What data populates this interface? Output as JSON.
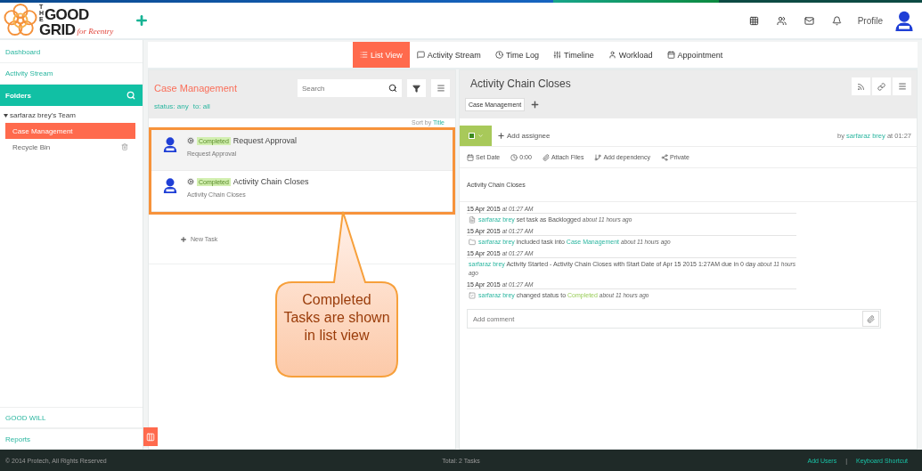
{
  "logo": {
    "small": "THE",
    "line1": "GOOD",
    "line2": "GRID",
    "tagline": "for Reentry"
  },
  "header": {
    "profile": "Profile"
  },
  "sidebar": {
    "top_items": [
      "Dashboard",
      "Activity Stream"
    ],
    "folders_label": "Folders",
    "team": "sarfaraz brey's Team",
    "folders": [
      {
        "label": "Case Management",
        "selected": true
      },
      {
        "label": "Recycle Bin",
        "selected": false
      }
    ],
    "bottom_items": [
      "GOOD WILL",
      "Reports"
    ]
  },
  "tabs": [
    {
      "label": "List View",
      "selected": true
    },
    {
      "label": "Activity Stream",
      "selected": false
    },
    {
      "label": "Time Log",
      "selected": false
    },
    {
      "label": "Timeline",
      "selected": false
    },
    {
      "label": "Workload",
      "selected": false
    },
    {
      "label": "Appointment",
      "selected": false
    }
  ],
  "list": {
    "title": "Case Management",
    "search": {
      "placeholder": "Search"
    },
    "filters": [
      "status: any",
      "to: all"
    ],
    "sort_label": "Sort by",
    "sort_value": "Title",
    "tasks": [
      {
        "status": "Completed",
        "title": "Request Approval",
        "subtitle": "Request Approval",
        "selected": true
      },
      {
        "status": "Completed",
        "title": "Activity Chain Closes",
        "subtitle": "Activity Chain Closes",
        "selected": false
      }
    ],
    "new_task": "New Task"
  },
  "callout": {
    "text": "Completed Tasks are shown in list view"
  },
  "detail": {
    "title": "Activity Chain Closes",
    "tag": "Case Management",
    "add_assignee": "Add assignee",
    "byline": {
      "prefix": "by",
      "user": "sarfaraz brey",
      "suffix": "at 01:27"
    },
    "tools": [
      "Set Date",
      "0:00",
      "Attach Files",
      "Add dependency",
      "Private"
    ],
    "description": "Activity Chain Closes",
    "activity": [
      {
        "date": "15 Apr 2015",
        "time": "at 01:27 AM",
        "kind": "backlog",
        "user": "sarfaraz brey",
        "text": "set task as Backlogged",
        "ago": "about 11 hours ago"
      },
      {
        "date": "15 Apr 2015",
        "time": "at 01:27 AM",
        "kind": "folder",
        "user": "sarfaraz brey",
        "text": "included task into",
        "target": {
          "text": "Case Management",
          "kind": "link"
        },
        "ago": "about 11 hours ago"
      },
      {
        "date": "15 Apr 2015",
        "time": "at 01:27 AM",
        "kind": "none",
        "user": "sarfaraz brey",
        "text": "Activity Started - Activity Chain Closes with Start Date of Apr 15 2015 1:27AM due in 0 day",
        "ago": "about 11 hours ago"
      },
      {
        "date": "15 Apr 2015",
        "time": "at 01:27 AM",
        "kind": "check",
        "user": "sarfaraz brey",
        "text": "changed status to",
        "target": {
          "text": "Completed",
          "kind": "status"
        },
        "ago": "about 11 hours ago"
      }
    ],
    "comment": {
      "placeholder": "Add comment"
    }
  },
  "footer": {
    "copyright": "© 2014 Protech, All Rights Reserved",
    "total": "Total: 2 Tasks",
    "links": [
      "Add Users",
      "Keyboard Shortcut"
    ],
    "separator": "|"
  }
}
